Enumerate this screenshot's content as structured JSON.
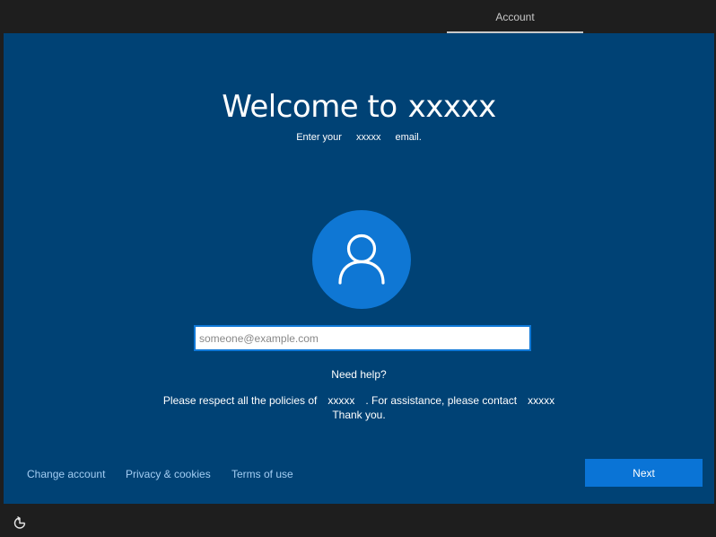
{
  "header": {
    "tab_label": "Account"
  },
  "main": {
    "title_prefix": "Welcome to",
    "title_org": "xxxxx",
    "subtitle_prefix": "Enter your",
    "subtitle_org": "xxxxx",
    "subtitle_suffix": "email.",
    "email_placeholder": "someone@example.com",
    "email_value": "",
    "need_help": "Need help?",
    "policy_prefix": "Please respect all the policies of",
    "policy_org": "xxxxx",
    "policy_middle": ". For assistance, please contact",
    "policy_contact": "xxxxx",
    "policy_thanks": "Thank you."
  },
  "footer": {
    "links": [
      "Change account",
      "Privacy & cookies",
      "Terms of use"
    ],
    "next_label": "Next"
  },
  "icons": {
    "avatar": "user-icon",
    "ease_of_access": "ease-of-access-icon"
  },
  "colors": {
    "panel_background": "#004275",
    "accent": "#0a74d6",
    "link": "#a3cdf3"
  }
}
